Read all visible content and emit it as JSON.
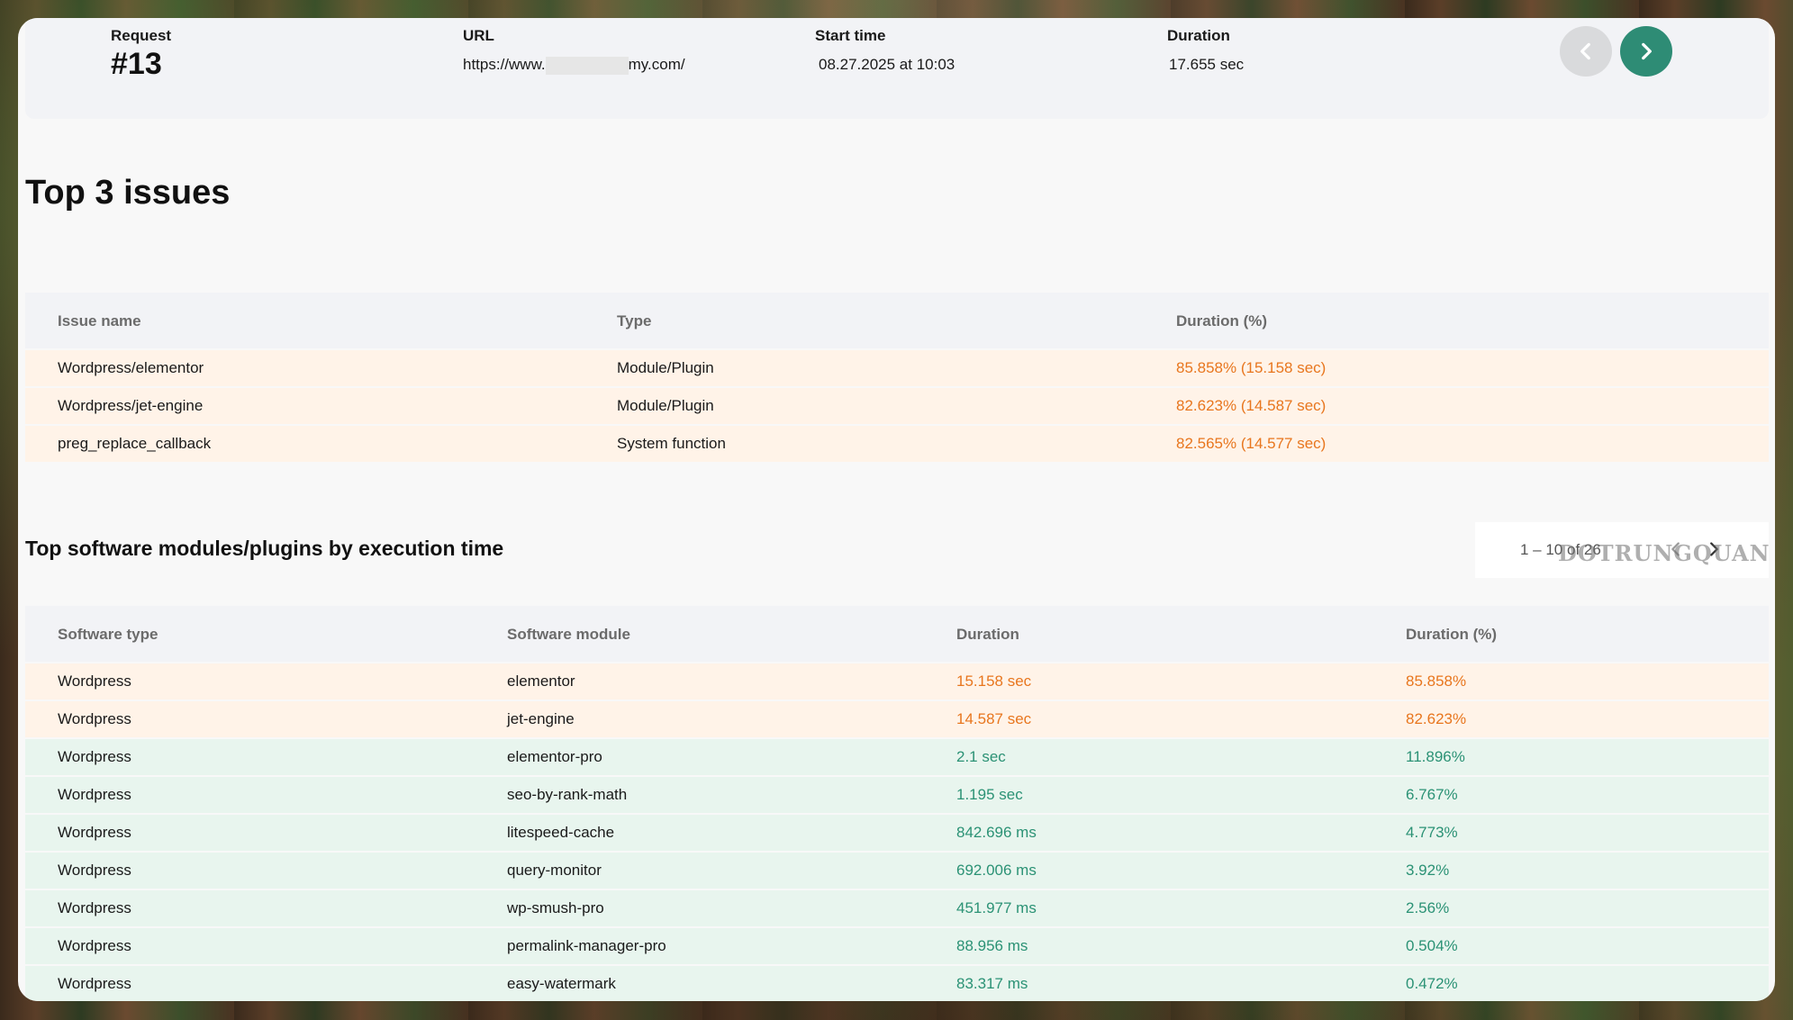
{
  "header": {
    "request_label": "Request",
    "request_value": "#13",
    "url_label": "URL",
    "url_prefix": "https://www.",
    "url_suffix": "my.com/",
    "start_label": "Start time",
    "start_value": "08.27.2025 at 10:03",
    "duration_label": "Duration",
    "duration_value": "17.655 sec",
    "prev_icon": "chevron-left-icon",
    "next_icon": "chevron-right-icon",
    "prev_color": "#d9dadc",
    "next_color": "#2e8c75"
  },
  "issues": {
    "title": "Top 3 issues",
    "columns": [
      "Issue name",
      "Type",
      "Duration (%)"
    ],
    "rows": [
      {
        "name": "Wordpress/elementor",
        "type": "Module/Plugin",
        "duration": "85.858% (15.158 sec)"
      },
      {
        "name": "Wordpress/jet-engine",
        "type": "Module/Plugin",
        "duration": "82.623% (14.587 sec)"
      },
      {
        "name": "preg_replace_callback",
        "type": "System function",
        "duration": "82.565% (14.577 sec)"
      }
    ]
  },
  "modules": {
    "title": "Top software modules/plugins by execution time",
    "pager_text": "1 – 10 of 26",
    "watermark": "DOTRUNGQUAN",
    "columns": [
      "Software type",
      "Software module",
      "Duration",
      "Duration (%)"
    ],
    "rows": [
      {
        "type": "Wordpress",
        "module": "elementor",
        "duration": "15.158 sec",
        "percent": "85.858%",
        "status": "orange"
      },
      {
        "type": "Wordpress",
        "module": "jet-engine",
        "duration": "14.587 sec",
        "percent": "82.623%",
        "status": "orange"
      },
      {
        "type": "Wordpress",
        "module": "elementor-pro",
        "duration": "2.1 sec",
        "percent": "11.896%",
        "status": "green"
      },
      {
        "type": "Wordpress",
        "module": "seo-by-rank-math",
        "duration": "1.195 sec",
        "percent": "6.767%",
        "status": "green"
      },
      {
        "type": "Wordpress",
        "module": "litespeed-cache",
        "duration": "842.696 ms",
        "percent": "4.773%",
        "status": "green"
      },
      {
        "type": "Wordpress",
        "module": "query-monitor",
        "duration": "692.006 ms",
        "percent": "3.92%",
        "status": "green"
      },
      {
        "type": "Wordpress",
        "module": "wp-smush-pro",
        "duration": "451.977 ms",
        "percent": "2.56%",
        "status": "green"
      },
      {
        "type": "Wordpress",
        "module": "permalink-manager-pro",
        "duration": "88.956 ms",
        "percent": "0.504%",
        "status": "green"
      },
      {
        "type": "Wordpress",
        "module": "easy-watermark",
        "duration": "83.317 ms",
        "percent": "0.472%",
        "status": "green"
      }
    ]
  },
  "colors": {
    "orange_text": "#e8761e",
    "green_text": "#2b9275",
    "orange_row": "#fff3e8",
    "green_row": "#e8f5ee"
  }
}
